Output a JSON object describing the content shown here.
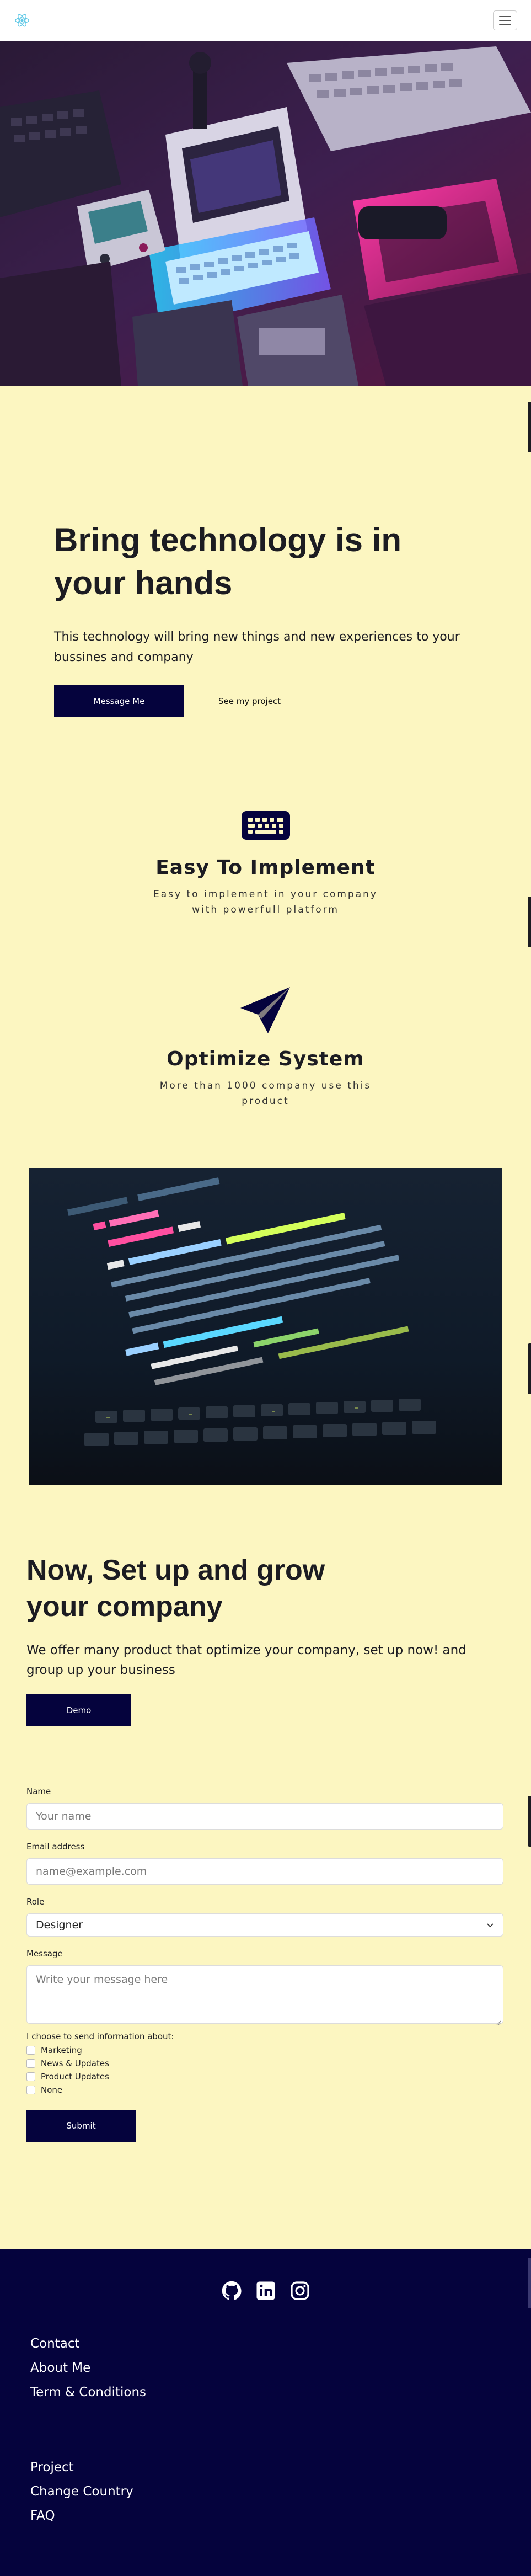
{
  "nav": {
    "logo_icon": "atom-logo-icon",
    "menu_icon": "hamburger-menu-icon"
  },
  "hero": {
    "image_icon": "retro-computer-photo"
  },
  "intro": {
    "headline": "Bring technology is in your hands",
    "subtext": "This technology will bring new things and new experiences to your bussines and company",
    "message_button": "Message Me",
    "project_link": "See my project"
  },
  "features": [
    {
      "icon": "keyboard-icon",
      "title": "Easy To Implement",
      "description": "Easy to implement in your company with powerfull platform"
    },
    {
      "icon": "paper-plane-icon",
      "title": "Optimize System",
      "description": "More than 1000 company use this product"
    }
  ],
  "code_image": {
    "image_icon": "code-laptop-photo"
  },
  "setup": {
    "title": "Now, Set up and grow your company",
    "text": "We offer many product that optimize your company, set up now! and group up your business",
    "demo_button": "Demo"
  },
  "form": {
    "name_label": "Name",
    "name_placeholder": "Your name",
    "email_label": "Email address",
    "email_placeholder": "name@example.com",
    "role_label": "Role",
    "role_value": "Designer",
    "message_label": "Message",
    "message_placeholder": "Write your message here",
    "checkbox_heading": "I choose to send information about:",
    "checkboxes": [
      "Marketing",
      "News & Updates",
      "Product Updates",
      "None"
    ],
    "submit_button": "Submit"
  },
  "footer": {
    "social_icons": [
      "github-icon",
      "linkedin-icon",
      "instagram-icon"
    ],
    "links_group1": [
      "Contact",
      "About Me",
      "Term & Conditions"
    ],
    "links_group2": [
      "Project",
      "Change Country",
      "FAQ"
    ]
  },
  "colors": {
    "page_background": "#fcf6c1",
    "accent_navy": "#05033d",
    "text": "#1c1c22"
  }
}
